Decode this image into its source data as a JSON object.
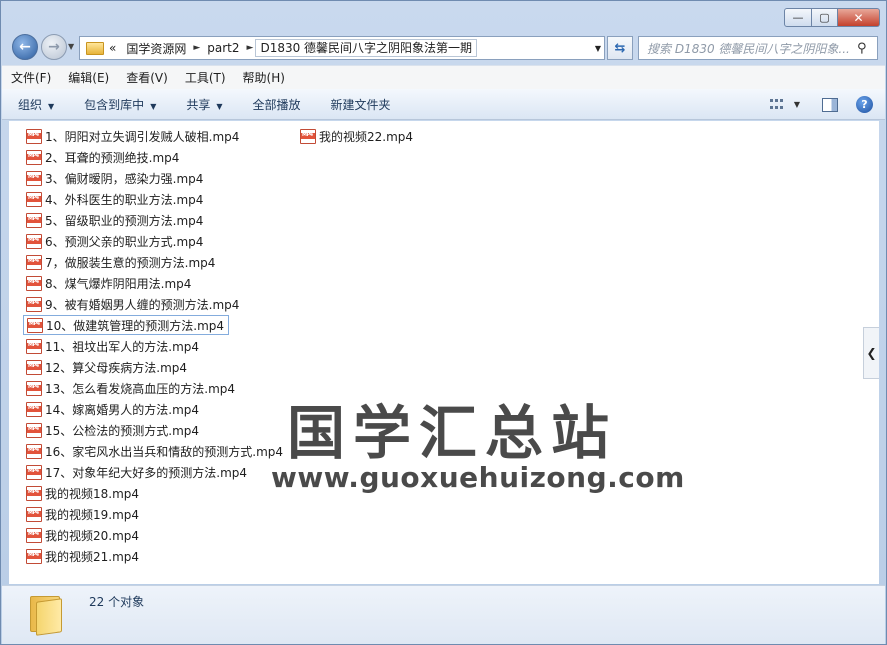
{
  "window": {
    "controls": {
      "minimize": "—",
      "maximize": "▢",
      "close": "✕"
    }
  },
  "address": {
    "overflow": "«",
    "crumbs": [
      "国学资源网",
      "part2",
      "D1830 德馨民间八字之阴阳象法第一期"
    ]
  },
  "search": {
    "placeholder": "搜索 D1830 德馨民间八字之阴阳象..."
  },
  "menu": [
    "文件(F)",
    "编辑(E)",
    "查看(V)",
    "工具(T)",
    "帮助(H)"
  ],
  "toolbar": {
    "organize": "组织",
    "include": "包含到库中",
    "share": "共享",
    "play_all": "全部播放",
    "new_folder": "新建文件夹",
    "help": "?"
  },
  "files": [
    "1、阴阳对立失调引发贼人破相.mp4",
    "2、耳聋的预测绝技.mp4",
    "3、偏财暧阴，感染力强.mp4",
    "4、外科医生的职业方法.mp4",
    "5、留级职业的预测方法.mp4",
    "6、预测父亲的职业方式.mp4",
    "7，做服装生意的预测方法.mp4",
    "8、煤气爆炸阴阳用法.mp4",
    "9、被有婚姻男人缠的预测方法.mp4",
    "10、做建筑管理的预测方法.mp4",
    "11、祖坟出军人的方法.mp4",
    "12、算父母疾病方法.mp4",
    "13、怎么看发烧高血压的方法.mp4",
    "14、嫁离婚男人的方法.mp4",
    "15、公检法的预测方式.mp4",
    "16、家宅风水出当兵和情敌的预测方式.mp4",
    "17、对象年纪大好多的预测方法.mp4",
    "我的视频18.mp4",
    "我的视频19.mp4",
    "我的视频20.mp4",
    "我的视频21.mp4",
    "我的视频22.mp4"
  ],
  "file_icon_label": "MP4",
  "watermark": {
    "line1": "国学汇总站",
    "line2": "www.guoxuehuizong.com"
  },
  "status": {
    "count": "22 个对象"
  }
}
